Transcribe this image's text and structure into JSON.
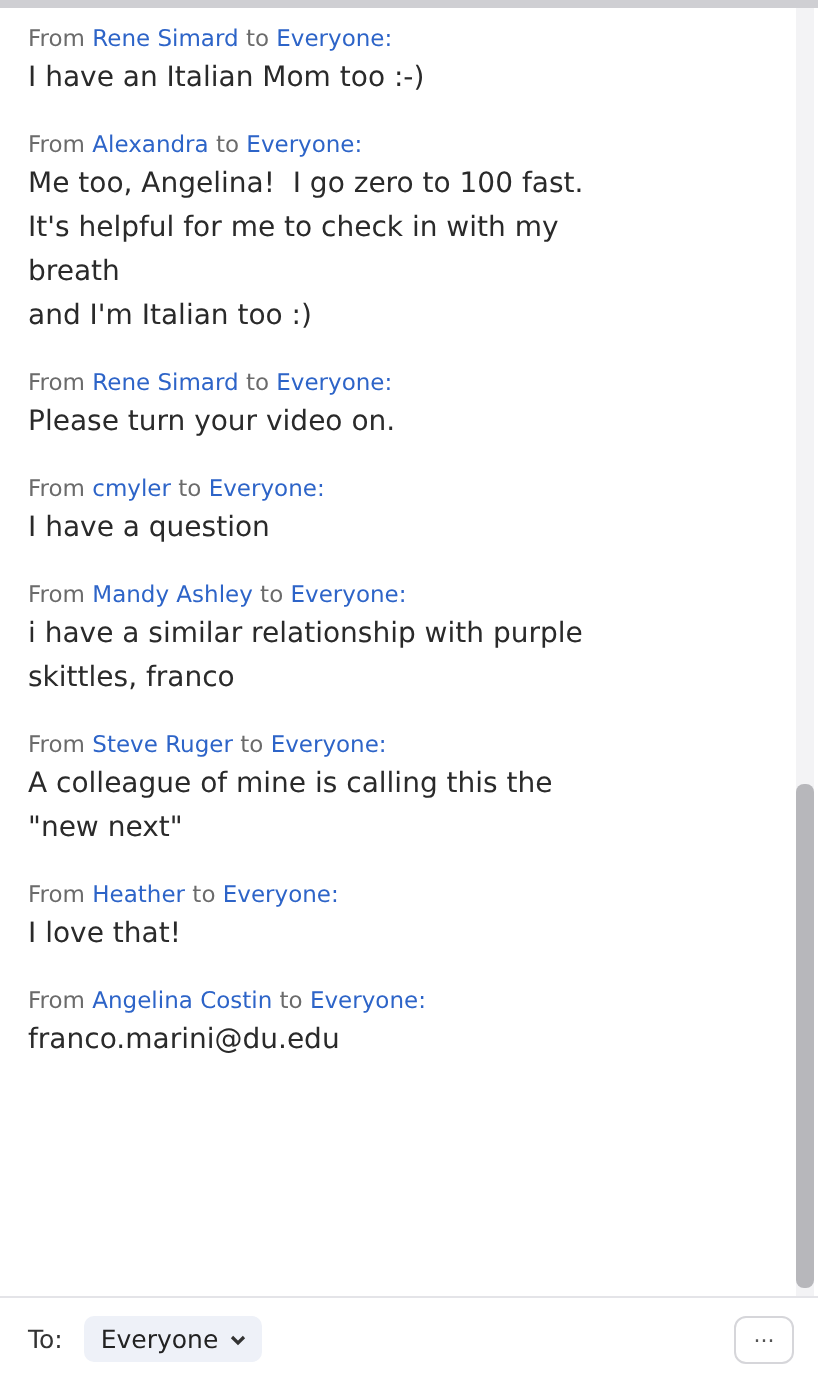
{
  "messages": [
    {
      "from_label": "From",
      "sender": "Rene Simard",
      "to_label": "to",
      "recipient": "Everyone:",
      "text": "I have an Italian Mom too :-)"
    },
    {
      "from_label": "From",
      "sender": "Alexandra",
      "to_label": "to",
      "recipient": "Everyone:",
      "text": "Me too, Angelina!  I go zero to 100 fast.\nIt's helpful for me to check in with my\nbreath\nand I'm Italian too :)"
    },
    {
      "from_label": "From",
      "sender": "Rene Simard",
      "to_label": "to",
      "recipient": "Everyone:",
      "text": "Please turn your video on."
    },
    {
      "from_label": "From",
      "sender": "cmyler",
      "to_label": "to",
      "recipient": "Everyone:",
      "text": "I have a question"
    },
    {
      "from_label": "From",
      "sender": "Mandy Ashley",
      "to_label": "to",
      "recipient": "Everyone:",
      "text": "i have a similar relationship with purple\nskittles, franco"
    },
    {
      "from_label": "From",
      "sender": "Steve Ruger",
      "to_label": "to",
      "recipient": "Everyone:",
      "text": "A colleague of mine is calling this the\n\"new next\""
    },
    {
      "from_label": "From",
      "sender": "Heather",
      "to_label": "to",
      "recipient": "Everyone:",
      "text": "I love that!"
    },
    {
      "from_label": "From",
      "sender": "Angelina Costin",
      "to_label": "to",
      "recipient": "Everyone:",
      "text": "franco.marini@du.edu"
    }
  ],
  "footer": {
    "to_label": "To:",
    "recipient": "Everyone",
    "more": "..."
  }
}
